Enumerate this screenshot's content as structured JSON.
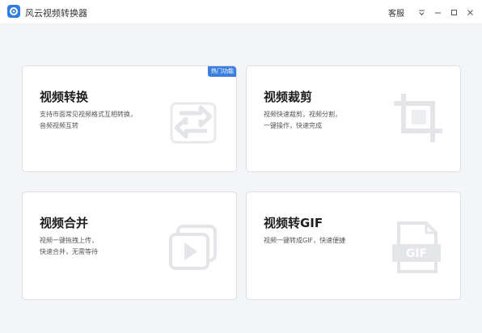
{
  "window": {
    "title": "风云视频转换器",
    "service_label": "客服",
    "controls": {
      "menu_icon": "menu-icon",
      "minimize_icon": "minimize-icon",
      "maximize_icon": "maximize-icon",
      "close_icon": "close-icon"
    }
  },
  "cards": [
    {
      "title": "视频转换",
      "desc": [
        "支持市面常见视频格式互相转换，",
        "音频视频互转"
      ],
      "badge": "热门功能",
      "icon": "convert-icon"
    },
    {
      "title": "视频裁剪",
      "desc": [
        "视频快速裁剪，视频分割，",
        "一键操作，快速完成"
      ],
      "icon": "crop-icon"
    },
    {
      "title": "视频合并",
      "desc": [
        "视频一键拖拽上传，",
        "快速合并，无需等待"
      ],
      "icon": "merge-play-icon"
    },
    {
      "title": "视频转GIF",
      "desc": [
        "视频一键转成GIF，快速便捷"
      ],
      "icon": "gif-file-icon",
      "icon_text": "GIF"
    }
  ],
  "colors": {
    "accent": "#3a7fe0",
    "icon_gray": "#e4e6ea",
    "background": "#f4f5f7"
  }
}
